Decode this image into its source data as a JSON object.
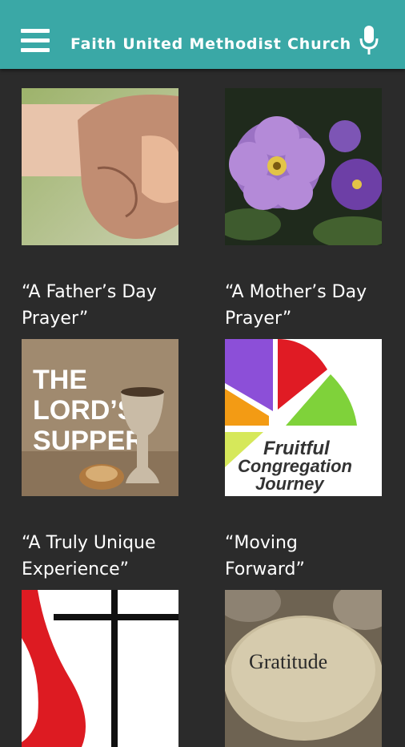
{
  "app": {
    "title": "Faith United Methodist Church",
    "icons": {
      "menu": "hamburger-menu-icon",
      "mic": "microphone-icon"
    }
  },
  "colors": {
    "appbar": "#3aa8a6",
    "background": "#2b2b2b",
    "text": "#ffffff"
  },
  "items": [
    {
      "line1": "“A Father’s Day",
      "line2": "Prayer”",
      "image": "holding-hands-photo"
    },
    {
      "line1": "“A Mother’s Day",
      "line2": "Prayer”",
      "image": "purple-flowers-photo"
    },
    {
      "line1": "“A Truly Unique",
      "line2": "Experience”",
      "image": "lords-supper-cup",
      "image_text": [
        "THE",
        "LORD’S",
        "SUPPER"
      ]
    },
    {
      "line1": "“Moving",
      "line2": "Forward”",
      "image": "fruitful-congregation-logo",
      "image_text": [
        "Fruitful",
        "Congregation",
        "Journey"
      ]
    },
    {
      "line1": "",
      "line2": "",
      "image": "cross-and-flame-logo"
    },
    {
      "line1": "",
      "line2": "",
      "image": "gratitude-stone",
      "image_text": [
        "Gratitude"
      ]
    }
  ]
}
